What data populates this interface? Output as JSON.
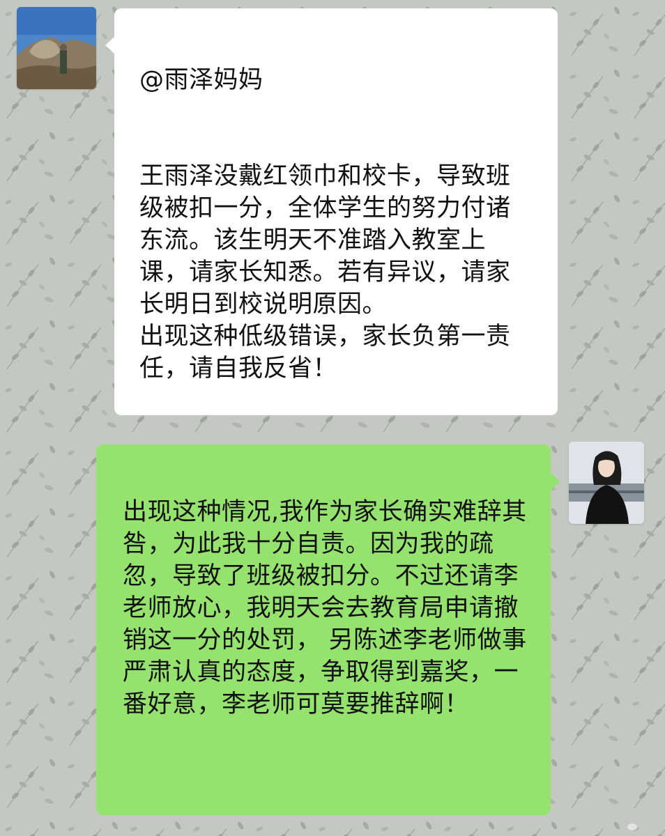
{
  "chat": {
    "messages": [
      {
        "side": "left",
        "avatar_icon": "mountain-landscape-avatar",
        "bubble_color": "#ffffff",
        "mention": "@雨泽妈妈",
        "text": "王雨泽没戴红领巾和校卡，导致班级被扣一分，全体学生的努力付诸东流。该生明天不准踏入教室上课，请家长知悉。若有异议，请家长明日到校说明原因。\n出现这种低级错误，家长负第一责任，请自我反省！"
      },
      {
        "side": "right",
        "avatar_icon": "woman-portrait-avatar",
        "bubble_color": "#95e26f",
        "text": "出现这种情况,我作为家长确实难辞其咎，为此我十分自责。因为我的疏忽，导致了班级被扣分。不过还请李老师放心，我明天会去教育局申请撤销这一分的处罚， 另陈述李老师做事严肃认真的态度，争取得到嘉奖，一番好意，李老师可莫要推辞啊！"
      }
    ]
  },
  "watermark": {
    "icon": "weibo-icon"
  },
  "colors": {
    "wallpaper": "#c3c8c2",
    "leaf": "#9ea69c",
    "sent_bubble": "#95e26f",
    "received_bubble": "#ffffff"
  }
}
